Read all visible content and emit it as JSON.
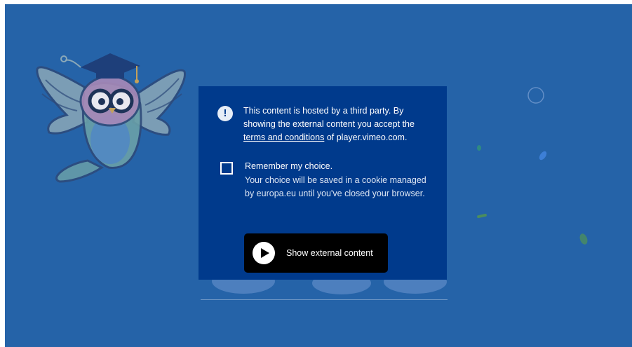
{
  "consent": {
    "notice_icon": "info-icon",
    "notice_text_before": "This content is hosted by a third party. By showing the external content you accept the ",
    "terms_link": "terms and conditions",
    "notice_text_after": " of player.vimeo.com.",
    "remember_title": "Remember my choice.",
    "remember_desc": "Your choice will be saved in a cookie managed by europa.eu until you've closed your browser.",
    "checkbox_checked": false,
    "show_button_label": "Show external content",
    "show_button_icon": "play-icon"
  },
  "colors": {
    "frame_background": "#2563a8",
    "consent_background": "#003a8c",
    "button_background": "#000000"
  }
}
